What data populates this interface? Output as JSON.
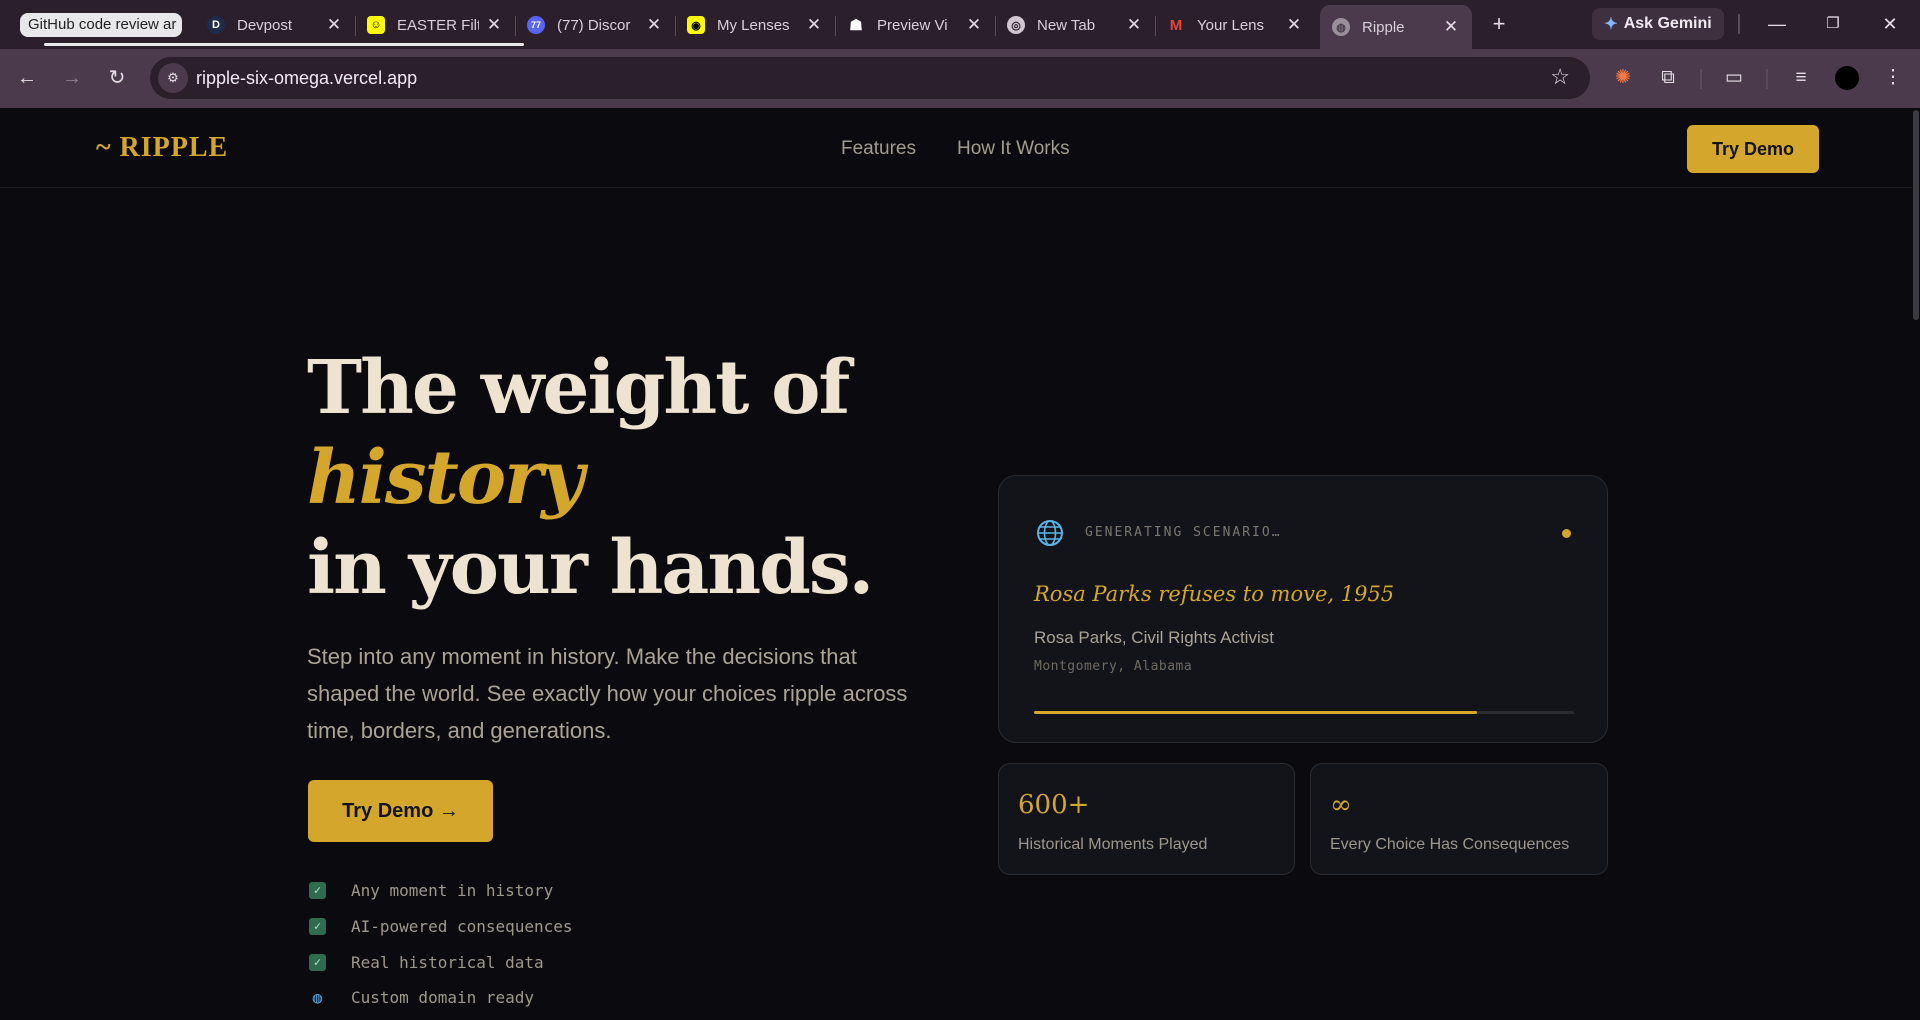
{
  "browser": {
    "tabs": [
      {
        "title": "GitHub code review ar",
        "favicon": "github-icon"
      },
      {
        "title": "Devpost",
        "favicon": "devpost-icon"
      },
      {
        "title": "EASTER Filt",
        "favicon": "snapchat-icon"
      },
      {
        "title": "(77) Discor",
        "favicon": "discord-icon",
        "badge": "77"
      },
      {
        "title": "My Lenses",
        "favicon": "lens-icon"
      },
      {
        "title": "Preview Vi",
        "favicon": "snapchat-ghost-icon"
      },
      {
        "title": "New Tab",
        "favicon": "chrome-icon"
      },
      {
        "title": "Your Lens",
        "favicon": "gmail-icon"
      },
      {
        "title": "Ripple",
        "favicon": "globe-icon",
        "active": true
      }
    ],
    "new_tab_symbol": "+",
    "gemini_label": "Ask Gemini",
    "url": "ripple-six-omega.vercel.app",
    "window_controls": {
      "minimize": "—",
      "restore": "❐",
      "close": "✕"
    }
  },
  "site": {
    "logo": "~ RIPPLE",
    "nav": {
      "features": "Features",
      "how_it_works": "How It Works"
    },
    "nav_cta": "Try Demo",
    "hero": {
      "line1": "The weight of",
      "line2": "history",
      "line3": "in your hands.",
      "subtitle": "Step into any moment in history. Make the decisions that shaped the world. See exactly how your choices ripple across time, borders, and generations.",
      "cta": "Try Demo →"
    },
    "features": [
      {
        "label": "Any moment in history",
        "icon": "check-icon"
      },
      {
        "label": "AI-powered consequences",
        "icon": "check-icon"
      },
      {
        "label": "Real historical data",
        "icon": "check-icon"
      },
      {
        "label": "Custom domain ready",
        "icon": "globe-icon"
      }
    ],
    "scenario_card": {
      "status": "GENERATING SCENARIO…",
      "title": "Rosa Parks refuses to move, 1955",
      "role": "Rosa Parks, Civil Rights Activist",
      "location": "Montgomery, Alabama",
      "progress": 0.82
    },
    "stats": [
      {
        "value": "600+",
        "label": "Historical Moments Played"
      },
      {
        "value": "∞",
        "label": "Every Choice Has Consequences"
      }
    ]
  },
  "colors": {
    "accent": "#d4a72c",
    "background": "#0b0b0f",
    "chrome": "#4a3a4b"
  }
}
